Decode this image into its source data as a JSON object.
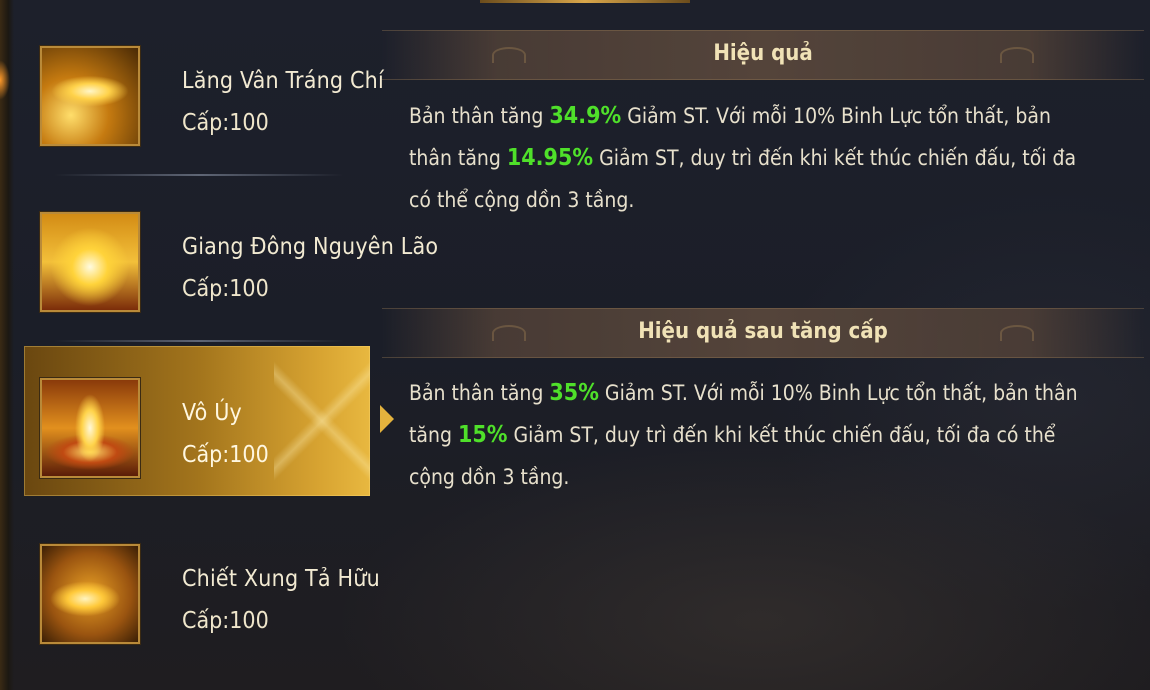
{
  "skills": [
    {
      "name": "Lăng Vân Tráng Chí",
      "level": "Cấp:100",
      "icon": "golden-slash-icon"
    },
    {
      "name": "Giang Đông Nguyên Lão",
      "level": "Cấp:100",
      "icon": "golden-burst-icon"
    },
    {
      "name": "Vô Úy",
      "level": "Cấp:100",
      "icon": "flame-pillar-icon",
      "selected": true
    },
    {
      "name": "Chiết Xung Tả Hữu",
      "level": "Cấp:100",
      "icon": "golden-whirl-icon"
    }
  ],
  "effect": {
    "title": "Hiệu quả",
    "t1": "Bản thân tăng ",
    "v1": "34.9%",
    "t2": " Giảm ST. Với mỗi 10% Binh Lực tổn thất, bản thân tăng ",
    "v2": "14.95%",
    "t3": " Giảm ST, duy trì đến khi kết thúc chiến đấu, tối đa có thể cộng dồn 3 tầng."
  },
  "upgrade_effect": {
    "title": "Hiệu quả sau tăng cấp",
    "t1": "Bản thân tăng ",
    "v1": "35%",
    "t2": " Giảm ST. Với mỗi 10% Binh Lực tổn thất, bản thân tăng ",
    "v2": "15%",
    "t3": " Giảm ST, duy trì đến khi kết thúc chiến đấu, tối đa có thể cộng dồn 3 tầng."
  },
  "colors": {
    "highlight": "#4fe02a",
    "gold": "#d7a331",
    "text": "#e7e0cc"
  }
}
